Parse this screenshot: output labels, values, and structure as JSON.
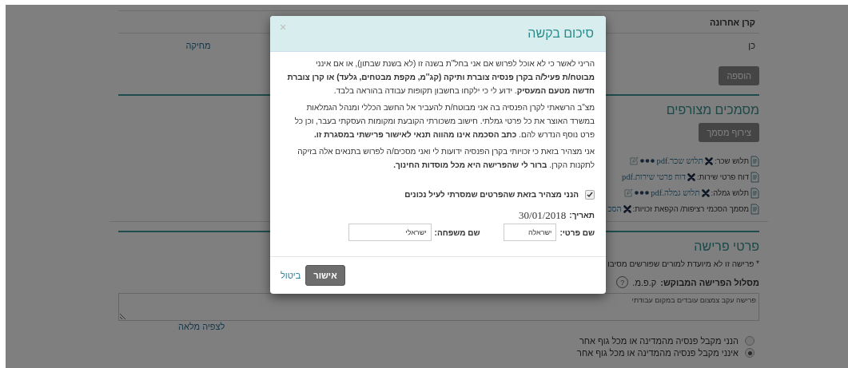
{
  "table": {
    "columns": [
      "קרן אחרונה"
    ],
    "rows": [
      {
        "cells": [
          "כן"
        ],
        "delete_link": "מחיקה"
      }
    ]
  },
  "add_button": "הוספה",
  "attachments": {
    "title": "מסמכים מצורפים",
    "attach_button": "צירוף מסמך",
    "documents": [
      {
        "label": "תלוש שכר:",
        "file": "תלוש שכר.pdf",
        "actions": true
      },
      {
        "label": "דוח פרטי שירות:",
        "file": "דוח פרטי שירות.pdf",
        "actions": false
      },
      {
        "label": "תלוש גמלה:",
        "file": "תלוש גמלה.pdf",
        "actions": true
      },
      {
        "label": "מסמך הסכמי רציפות/ הקפאת זכויות:",
        "file": "הסכ",
        "actions": false
      }
    ]
  },
  "retirement": {
    "title": "פרטי פרישה",
    "note": "* פרישה זו לא מיועדת למורים שפורשים מסיבו",
    "route_label": "מסלול הפרישה המבוקש:",
    "route_value": "ק.פ.מ.",
    "help": "?",
    "reason": "פרישה עקב צמצום עובדים במקום עבודתי",
    "full_view_link": "לצפיה מלאה",
    "options": [
      {
        "label": "הנני מקבל פנסיה מהמדינה או מכל גוף אחר",
        "selected": false
      },
      {
        "label": "אינני מקבל פנסיה מהמדינה או מכל גוף אחר",
        "selected": true
      }
    ]
  },
  "dialog": {
    "title": "סיכום בקשה",
    "close": "×",
    "paragraphs": [
      "הריני לאשר כי לא אוכל לפרוש אם אני בחל\"ת בשנה זו (לא בשנת שבתון), או אם אינני **מבוטח/ת פעיל/ה בקרן פנסיה צוברת ותיקה (קג''מ, מקפת מבטחים, גלעד) או קרן צוברת חדשה מטעם המעסיק**. ידוע לי כי ילקחו בחשבון תקופות עבודה בהוראה בלבד.",
      "מצ\"ב הרשאתי לקרן הפנסיה בה אני מבוטח/ת להעביר אל החשב הכללי ומנהל הגמלאות במשרד האוצר את כל פרטי גמלתי. חישוב משכורתי הקובעת ומקומות העסקתי בעבר, וכן כל פרט נוסף הנדרש להם. **כתב הסכמה אינו מהווה תנאי לאישור פרישתי במסגרת זו.**",
      "אני מצהיר בזאת כי זכויותי בקרן הפנסיה ידועות לי ואני מסכים/ה לפרוש בתנאים אלה בזיקה לתקנות הקרן. **ברור לי שהפרישה היא מכל מוסדות החינוך.**"
    ],
    "declaration": {
      "label": "הנני מצהיר בזאת שהפרטים שמסרתי לעיל נכונים",
      "checked": true
    },
    "date_label": "תאריך:",
    "date": "30/01/2018",
    "fields": [
      {
        "label": "שם פרטי:",
        "value": "ישראלה"
      },
      {
        "label": "שם משפחה:",
        "value": "ישראלי"
      }
    ],
    "confirm_button": "אישור",
    "cancel_link": "ביטול"
  }
}
